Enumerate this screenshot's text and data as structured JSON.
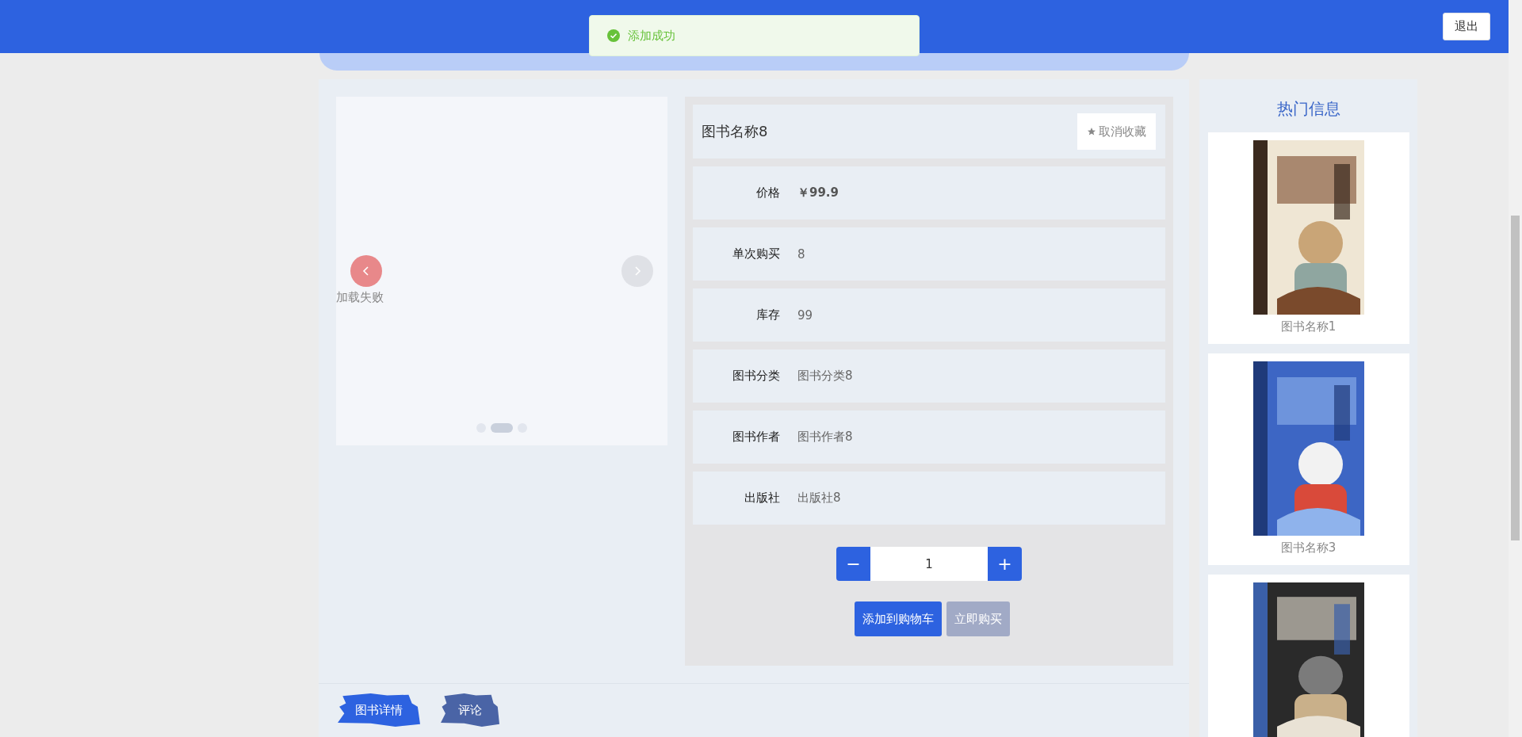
{
  "header": {
    "logout_button": "退出"
  },
  "toast": {
    "message": "添加成功"
  },
  "carousel": {
    "error_text": "加载失败",
    "indicators": [
      {
        "selected": false
      },
      {
        "selected": true
      },
      {
        "selected": false
      }
    ]
  },
  "book": {
    "title": "图书名称8",
    "favorite_button": "取消收藏",
    "fields": [
      {
        "label": "价格",
        "value": "￥99.9",
        "kind": "price"
      },
      {
        "label": "单次购买",
        "value": "8",
        "kind": "plain"
      },
      {
        "label": "库存",
        "value": "99",
        "kind": "plain"
      },
      {
        "label": "图书分类",
        "value": "图书分类8",
        "kind": "plain"
      },
      {
        "label": "图书作者",
        "value": "图书作者8",
        "kind": "plain"
      },
      {
        "label": "出版社",
        "value": "出版社8",
        "kind": "plain"
      }
    ],
    "quantity": {
      "minus": "−",
      "value": "1",
      "plus": "+"
    },
    "buttons": [
      {
        "label": "添加到购物车",
        "disabled": false
      },
      {
        "label": "立即购买",
        "disabled": true
      }
    ]
  },
  "detail_tabs": [
    {
      "label": "图书详情",
      "selected": true
    },
    {
      "label": "评论",
      "selected": false
    }
  ],
  "hot_info": {
    "title": "热门信息",
    "items": [
      {
        "title": "图书名称1",
        "kind": "picture"
      },
      {
        "title": "图书名称3",
        "kind": "picture"
      },
      {
        "kind": "picture"
      }
    ]
  }
}
